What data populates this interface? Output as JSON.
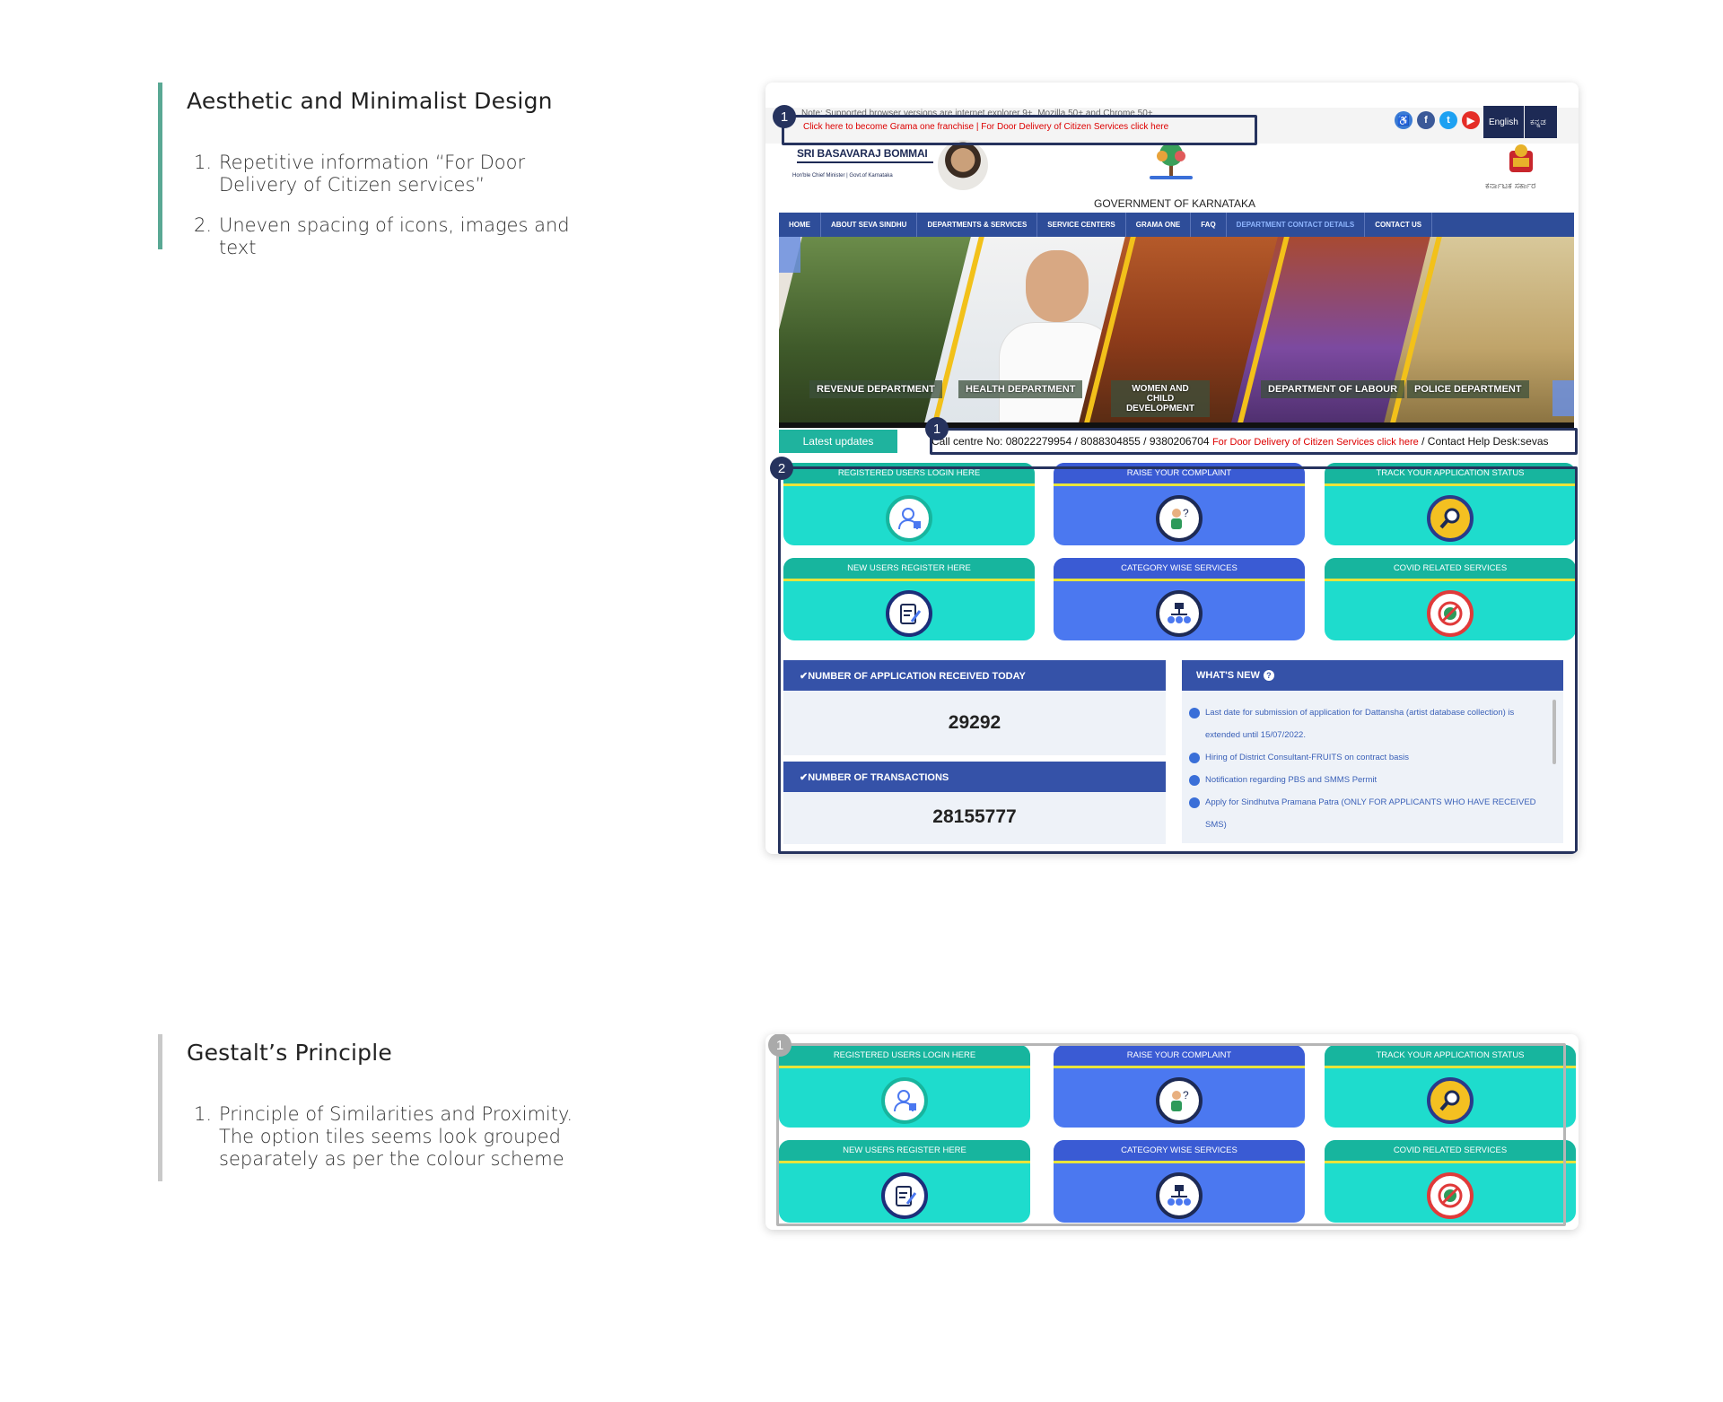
{
  "notes": [
    {
      "title": "Aesthetic and Minimalist Design",
      "accent": "#5aa894",
      "items": [
        {
          "num": "1.",
          "text": "Repetitive information “For Door Delivery of Citizen services”"
        },
        {
          "num": "2.",
          "text": "Uneven spacing of icons, images and text"
        }
      ]
    },
    {
      "title": "Gestalt’s Principle",
      "accent": "#c9c9c9",
      "items": [
        {
          "num": "1.",
          "text": "Principle of Similarities and Proximity. The option tiles seems look grouped separately as per the colour scheme"
        }
      ]
    }
  ],
  "site": {
    "top_note": "Note: Supported browser versions are internet explorer 9+, Mozilla 50+ and Chrome 50+",
    "franchise_link": "Click here to become Grama one franchise | For Door Delivery of Citizen Services click here",
    "social_icons": [
      "accessibility-icon",
      "facebook-icon",
      "twitter-icon",
      "youtube-icon"
    ],
    "lang_english": "English",
    "lang_kannada": "ಕನ್ನಡ",
    "cm_name": "SRI BASAVARAJ BOMMAI",
    "cm_title": "Hon'ble Chief Minister | Govt.of Karnataka",
    "gov_title": "GOVERNMENT OF KARNATAKA",
    "emblem_caption": "ಕರ್ನಾಟಕ ಸರ್ಕಾರ",
    "nav": [
      "HOME",
      "ABOUT SEVA SINDHU",
      "DEPARTMENTS & SERVICES",
      "SERVICE CENTERS",
      "GRAMA ONE",
      "FAQ",
      "DEPARTMENT CONTACT DETAILS",
      "CONTACT US"
    ],
    "banner_labels": [
      "REVENUE DEPARTMENT",
      "HEALTH DEPARTMENT",
      "WOMEN AND CHILD DEVELOPMENT",
      "DEPARTMENT OF LABOUR",
      "POLICE DEPARTMENT"
    ],
    "latest_updates": "Latest updates",
    "ticker_main": "Call centre No: 08022279954 / 8088304855 / 9380206704 ",
    "ticker_red": "For Door Delivery of Citizen Services click here",
    "ticker_tail": " / Contact Help Desk:sevas",
    "tiles": [
      {
        "label": "REGISTERED USERS LOGIN HERE",
        "icon": "user-lock-icon",
        "color": "teal"
      },
      {
        "label": "RAISE YOUR COMPLAINT",
        "icon": "complaint-person-icon",
        "color": "blue"
      },
      {
        "label": "TRACK YOUR APPLICATION STATUS",
        "icon": "magnifier-icon",
        "color": "teal"
      },
      {
        "label": "NEW USERS REGISTER HERE",
        "icon": "clipboard-pen-icon",
        "color": "teal"
      },
      {
        "label": "CATEGORY WISE SERVICES",
        "icon": "hierarchy-icon",
        "color": "blue"
      },
      {
        "label": "COVID RELATED SERVICES",
        "icon": "no-virus-icon",
        "color": "teal"
      }
    ],
    "app_today_label": "✔NUMBER OF APPLICATION RECEIVED TODAY",
    "app_today_value": "29292",
    "transactions_label": "✔NUMBER OF TRANSACTIONS",
    "transactions_value": "28155777",
    "whats_new_label": "WHAT'S NEW",
    "news": [
      "Last date for submission of application for Dattansha (artist database collection) is extended until 15/07/2022.",
      "Hiring of District Consultant-FRUITS on contract basis",
      "Notification regarding PBS and SMMS Permit",
      "Apply for Sindhutva Pramana Patra (ONLY FOR APPLICANTS WHO HAVE RECEIVED SMS)"
    ]
  },
  "markers": {
    "one": "1",
    "two": "2"
  }
}
